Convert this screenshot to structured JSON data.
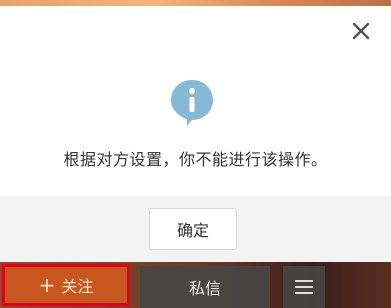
{
  "dialog": {
    "message": "根据对方设置，你不能进行该操作。",
    "ok_label": "确定",
    "close_icon": "close-icon",
    "info_icon": "info-icon",
    "info_color": "#7fb6d6"
  },
  "actions": {
    "follow_plus": "+",
    "follow_label": "关注",
    "message_label": "私信",
    "menu_icon": "menu-icon"
  }
}
